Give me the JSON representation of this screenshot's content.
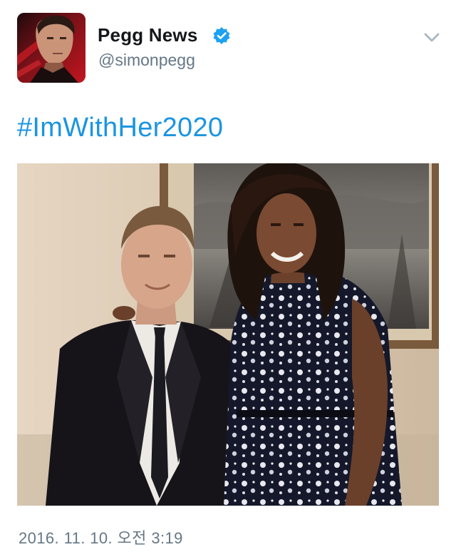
{
  "tweet": {
    "author": {
      "display_name": "Pegg News",
      "handle": "@simonpegg",
      "verified": true,
      "avatar_icon": "profile-avatar"
    },
    "text": "#ImWithHer2020",
    "hashtag_color": "#1b95e0",
    "timestamp": "2016. 11. 10. 오전 3:19",
    "menu_icon": "chevron-down-icon",
    "verified_color": "#1da1f2"
  }
}
